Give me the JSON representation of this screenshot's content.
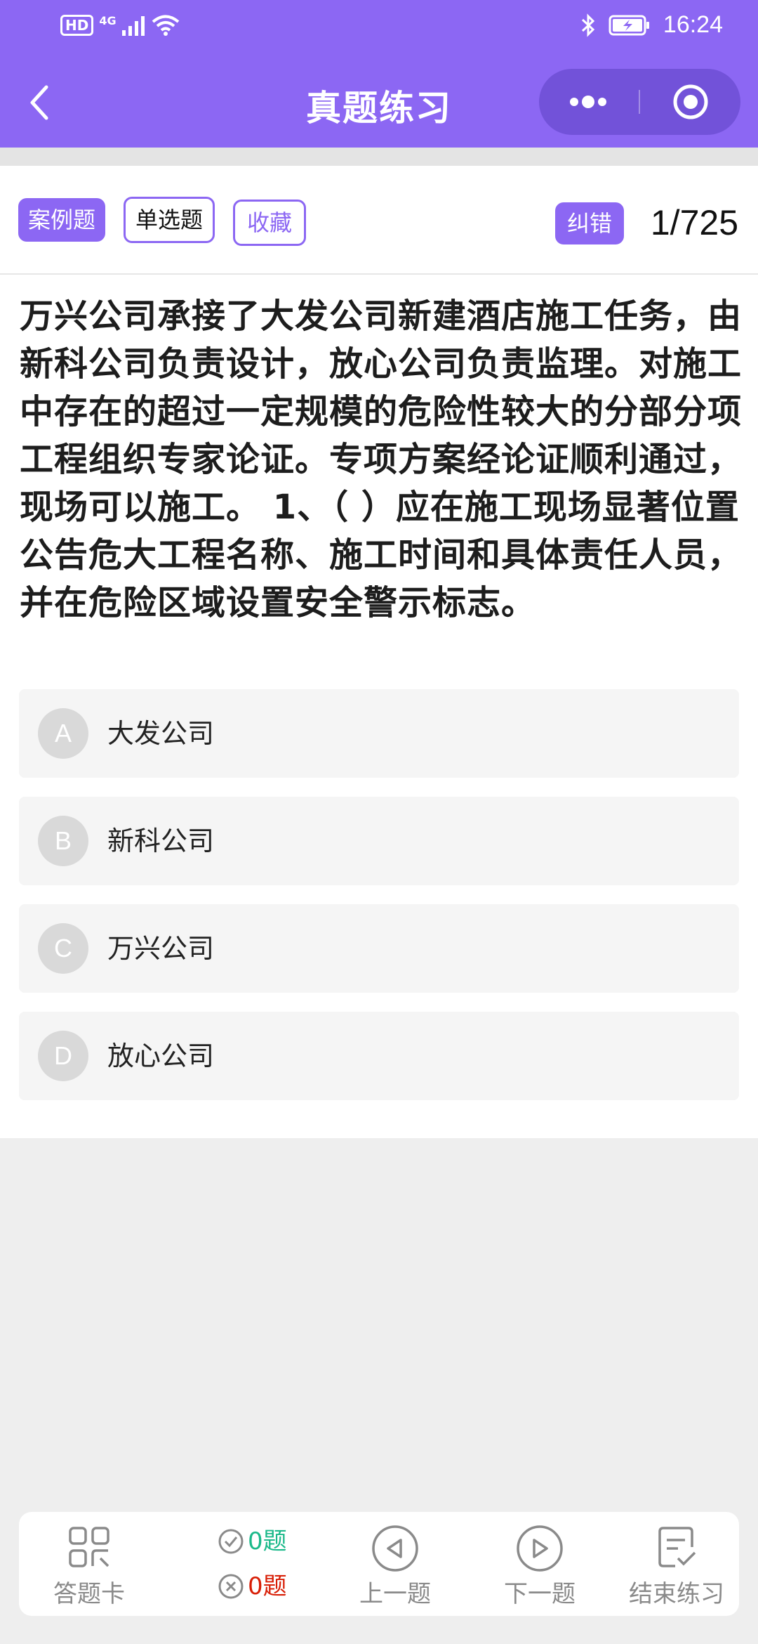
{
  "status_bar": {
    "hd": "HD",
    "network": "4G",
    "time": "16:24"
  },
  "nav": {
    "title": "真题练习"
  },
  "tags": {
    "case": "案例题",
    "single": "单选题",
    "favorite": "收藏",
    "correct_error": "纠错"
  },
  "counter": "1/725",
  "question": "万兴公司承接了大发公司新建酒店施工任务，由新科公司负责设计，放心公司负责监理。对施工中存在的超过一定规模的危险性较大的分部分项工程组织专家论证。专项方案经论证顺利通过，现场可以施工。 1、（ ）应在施工现场显著位置公告危大工程名称、施工时间和具体责任人员，并在危险区域设置安全警示标志。",
  "options": [
    {
      "letter": "A",
      "text": "大发公司"
    },
    {
      "letter": "B",
      "text": "新科公司"
    },
    {
      "letter": "C",
      "text": "万兴公司"
    },
    {
      "letter": "D",
      "text": "放心公司"
    }
  ],
  "bottom_bar": {
    "answer_card": "答题卡",
    "correct_count": "0题",
    "wrong_count": "0题",
    "prev": "上一题",
    "next": "下一题",
    "finish": "结束练习"
  },
  "colors": {
    "accent": "#8c67f3",
    "correct": "#1bb98a",
    "wrong": "#d81e06"
  }
}
